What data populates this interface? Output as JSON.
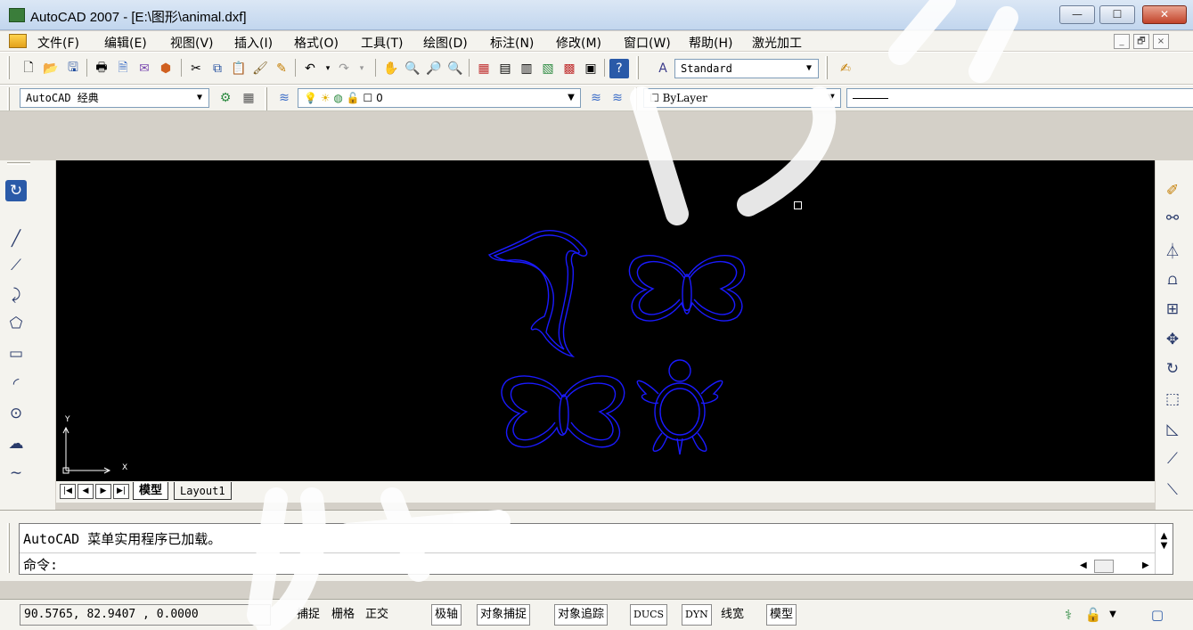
{
  "window": {
    "title": "AutoCAD 2007 - [E:\\图形\\animal.dxf]",
    "controls": {
      "minimize": "—",
      "maximize": "☐",
      "close": "✕"
    }
  },
  "menubar": {
    "items": [
      "文件(F)",
      "编辑(E)",
      "视图(V)",
      "插入(I)",
      "格式(O)",
      "工具(T)",
      "绘图(D)",
      "标注(N)",
      "修改(M)",
      "窗口(W)",
      "帮助(H)",
      "激光加工"
    ],
    "mdi_controls": [
      "_",
      "🗗",
      "×"
    ]
  },
  "standard_toolbar": {
    "text_style": "Standard"
  },
  "workspace_toolbar": {
    "workspace": "AutoCAD 经典",
    "layer": "0",
    "color": "ByLayer"
  },
  "drawing": {
    "background": "#000000",
    "entity_color": "#1a1aff",
    "ucs_y": "Y",
    "ucs_x": "X"
  },
  "layout_tabs": {
    "nav": [
      "|◀",
      "◀",
      "▶",
      "▶|"
    ],
    "tabs": [
      "模型",
      "Layout1"
    ]
  },
  "command": {
    "history": "AutoCAD 菜单实用程序已加载。",
    "prompt": "命令:"
  },
  "statusbar": {
    "coords": "90.5765,  82.9407  , 0.0000",
    "toggles": [
      {
        "label": "捕捉",
        "on": false
      },
      {
        "label": "栅格",
        "on": false
      },
      {
        "label": "正交",
        "on": false
      },
      {
        "label": "极轴",
        "on": true
      },
      {
        "label": "对象捕捉",
        "on": true
      },
      {
        "label": "对象追踪",
        "on": true
      },
      {
        "label": "DUCS",
        "on": true
      },
      {
        "label": "DYN",
        "on": true
      },
      {
        "label": "线宽",
        "on": false
      },
      {
        "label": "模型",
        "on": true
      }
    ]
  }
}
